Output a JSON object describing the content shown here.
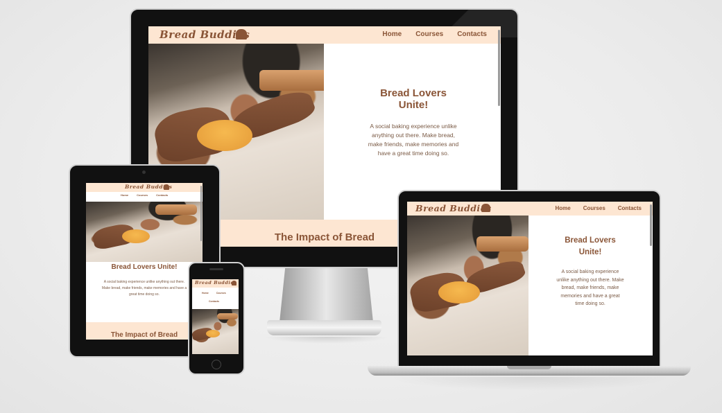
{
  "site": {
    "logo_text": "Bread Buddies",
    "nav": [
      "Home",
      "Courses",
      "Contacts"
    ],
    "hero_title": "Bread Lovers Unite!",
    "hero_text": "A social baking experience unlike anything out there. Make bread, make friends, make memories and have a great time doing so.",
    "section_title": "The Impact of Bread"
  },
  "laptop_hero_title": [
    "Bread Lovers",
    "Unite!"
  ],
  "colors": {
    "accent": "#8a5537",
    "nav_bg": "#fde6d2",
    "bezel": "#0d0d0d",
    "background": "#ececec"
  },
  "icons": [
    "bread-icon"
  ]
}
